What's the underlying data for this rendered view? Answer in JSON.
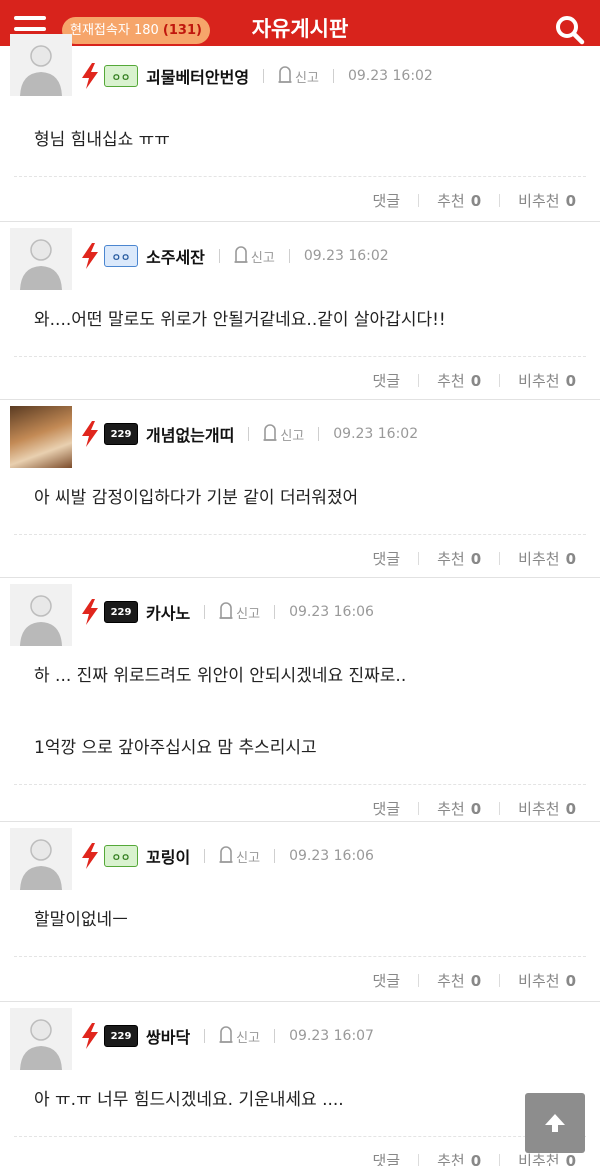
{
  "header": {
    "online_label": "현재접속자",
    "online_total": "180",
    "online_now": "(131)",
    "title": "자유게시판"
  },
  "labels": {
    "report": "신고",
    "reply": "댓글",
    "recommend": "추천",
    "not_recommend": "비추천"
  },
  "comments": [
    {
      "nick": "괴물베터안번영",
      "level_badge": "green",
      "avatar": "default",
      "date": "09.23 16:02",
      "lines": [
        "형님 힘내십쇼 ㅠㅠ"
      ],
      "recommend": "0",
      "not_recommend": "0"
    },
    {
      "nick": "소주세잔",
      "level_badge": "blue",
      "avatar": "default",
      "date": "09.23 16:02",
      "lines": [
        "와....어떤 말로도 위로가 안될거같네요..같이 살아갑시다!!"
      ],
      "recommend": "0",
      "not_recommend": "0"
    },
    {
      "nick": "개념없는개띠",
      "level_badge": "black",
      "avatar": "photo",
      "date": "09.23 16:02",
      "lines": [
        "아 씨발 감정이입하다가 기분 같이 더러워졌어"
      ],
      "recommend": "0",
      "not_recommend": "0"
    },
    {
      "nick": "카사노",
      "level_badge": "black",
      "avatar": "default",
      "date": "09.23 16:06",
      "lines": [
        "하 ... 진짜 위로드려도 위안이 안되시겠네요 진짜로..",
        "1억깡 으로 갚아주십시요 맘 추스리시고"
      ],
      "recommend": "0",
      "not_recommend": "0"
    },
    {
      "nick": "꼬링이",
      "level_badge": "green",
      "avatar": "default",
      "date": "09.23 16:06",
      "lines": [
        "할말이없네ㅡ"
      ],
      "recommend": "0",
      "not_recommend": "0"
    },
    {
      "nick": "쌍바닥",
      "level_badge": "black",
      "avatar": "default",
      "date": "09.23 16:07",
      "lines": [
        "아 ㅠ.ㅠ 너무 힘드시겠네요. 기운내세요 ...."
      ],
      "recommend": "0",
      "not_recommend": "0"
    }
  ],
  "icons": {
    "menu": "hamburger-menu-icon",
    "search": "magnifier-search-icon",
    "bolt": "lightning-bolt-icon",
    "report": "tombstone-report-icon",
    "scroll_top": "arrow-up-icon"
  },
  "colors": {
    "header_bg": "#d8231c",
    "online_badge_bg": "#f6a56a",
    "bolt": "#e0261d",
    "scroll_top_bg": "#8d8d8d"
  }
}
